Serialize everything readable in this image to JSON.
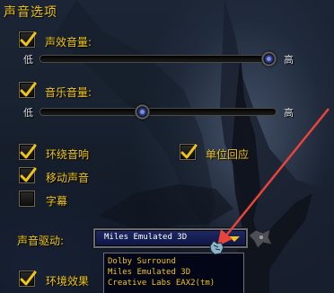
{
  "section": {
    "title": "声音选项"
  },
  "sound_effects": {
    "label": "声效音量:",
    "checked": true,
    "min_label": "低",
    "max_label": "高",
    "level": 0.97
  },
  "music": {
    "label": "音乐音量:",
    "checked": true,
    "min_label": "低",
    "max_label": "高",
    "level": 0.43
  },
  "checkboxes": {
    "ambient": {
      "label": "环绕音响",
      "checked": true
    },
    "unit_response": {
      "label": "单位回应",
      "checked": true
    },
    "movement": {
      "label": "移动声音",
      "checked": true
    },
    "subtitles": {
      "label": "字幕",
      "checked": false
    },
    "environment": {
      "label": "环境效果",
      "checked": true
    }
  },
  "driver": {
    "label": "声音驱动:",
    "selected": "Miles Emulated 3D",
    "options": [
      "Dolby Surround",
      "Miles Emulated 3D",
      "Creative Labs EAX2(tm)"
    ]
  },
  "colors": {
    "label": "#f0c419",
    "annotation_arrow": "#e8443a",
    "dropdown_bg": "#0c1540"
  },
  "icons": {
    "check": "check-icon",
    "arrow": "chevron-down-icon",
    "pointer": "hand-pointer-icon"
  }
}
